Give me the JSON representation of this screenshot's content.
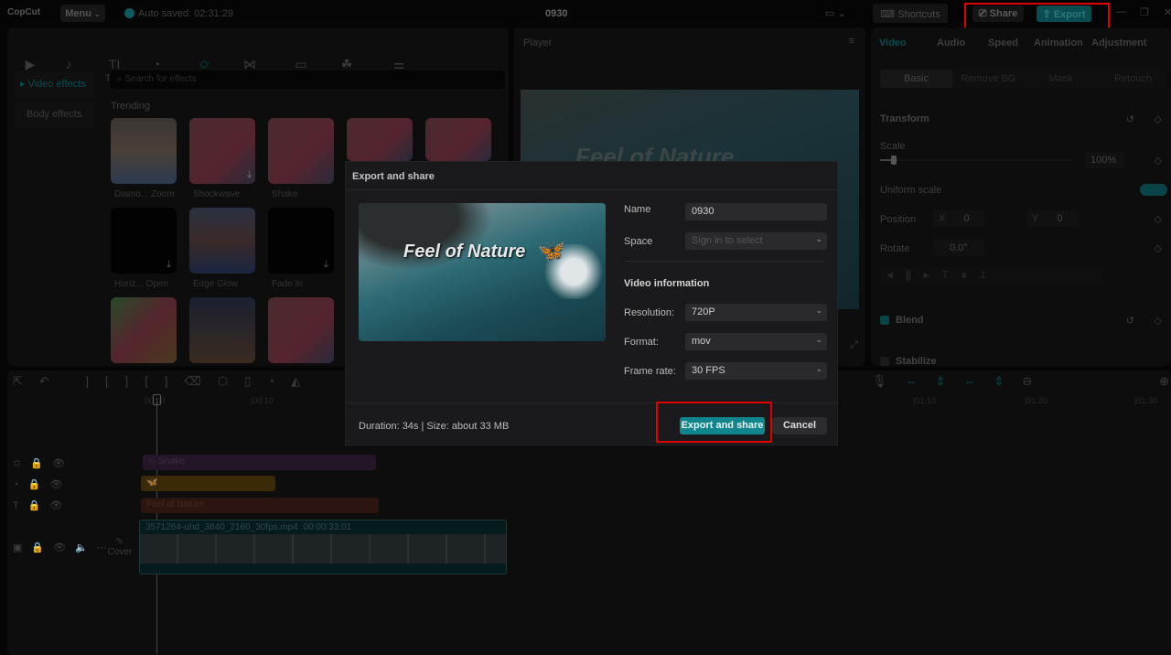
{
  "app": {
    "logo": "CopCut",
    "menu": "Menu",
    "autosave": "Auto saved: 02:31:29",
    "project_title": "0930",
    "shortcuts": "Shortcuts",
    "share": "Share",
    "export": "Export"
  },
  "media_tabs": [
    {
      "label": "Import",
      "icon": "▶"
    },
    {
      "label": "Audio",
      "icon": "♪"
    },
    {
      "label": "Text",
      "icon": "TI"
    },
    {
      "label": "Stickers",
      "icon": "◔"
    },
    {
      "label": "Effects",
      "icon": "✩"
    },
    {
      "label": "Transitions",
      "icon": "⋈"
    },
    {
      "label": "Captions",
      "icon": "▭"
    },
    {
      "label": "Filters",
      "icon": "☘"
    },
    {
      "label": "Adjustment",
      "icon": "⚌"
    }
  ],
  "effects_sidebar": [
    "▸ Video effects",
    "Body effects"
  ],
  "search_placeholder": "Search for effects",
  "trending_label": "Trending",
  "effects": [
    "Diamo... Zoom",
    "Shockwave",
    "Shake",
    "",
    "",
    "Horiz... Open",
    "Edge Glow",
    "Fade In"
  ],
  "player": {
    "title": "Player",
    "overlay_text": "Feel of Nature"
  },
  "right_tabs": [
    "Video",
    "Audio",
    "Speed",
    "Animation",
    "Adjustment"
  ],
  "right_subtabs": [
    "Basic",
    "Remove BG",
    "Mask",
    "Retouch"
  ],
  "transform": {
    "title": "Transform",
    "scale_label": "Scale",
    "scale_value": "100%",
    "scale_fraction": 0.07,
    "uniform_scale": "Uniform scale",
    "position_label": "Position",
    "x_label": "X",
    "x": "0",
    "y_label": "Y",
    "y": "0",
    "rotate_label": "Rotate",
    "rotate": "0.0°"
  },
  "blend": "Blend",
  "stabilize": "Stabilize",
  "timeline": {
    "ticks": [
      "00:00",
      "|00:10",
      "|01:10",
      "|01:20",
      "|01:30"
    ],
    "tracks": {
      "effect": "Shake",
      "text": "Feel of Nature",
      "video": "3571264-uhd_3840_2160_30fps.mp4",
      "video_duration": "00:00:33:01"
    },
    "cover": "Cover"
  },
  "dialog": {
    "title": "Export and share",
    "overlay_text": "Feel of Nature",
    "name_label": "Name",
    "name_value": "0930",
    "space_label": "Space",
    "space_placeholder": "Sign in to select",
    "section": "Video information",
    "resolution_label": "Resolution:",
    "resolution": "720P",
    "format_label": "Format:",
    "format": "mov",
    "framerate_label": "Frame rate:",
    "framerate": "30 FPS",
    "footer": "Duration: 34s | Size: about 33 MB",
    "export_button": "Export and share",
    "cancel_button": "Cancel"
  },
  "colors": {
    "accent": "#0f8d95",
    "highlight": "#e00000"
  }
}
